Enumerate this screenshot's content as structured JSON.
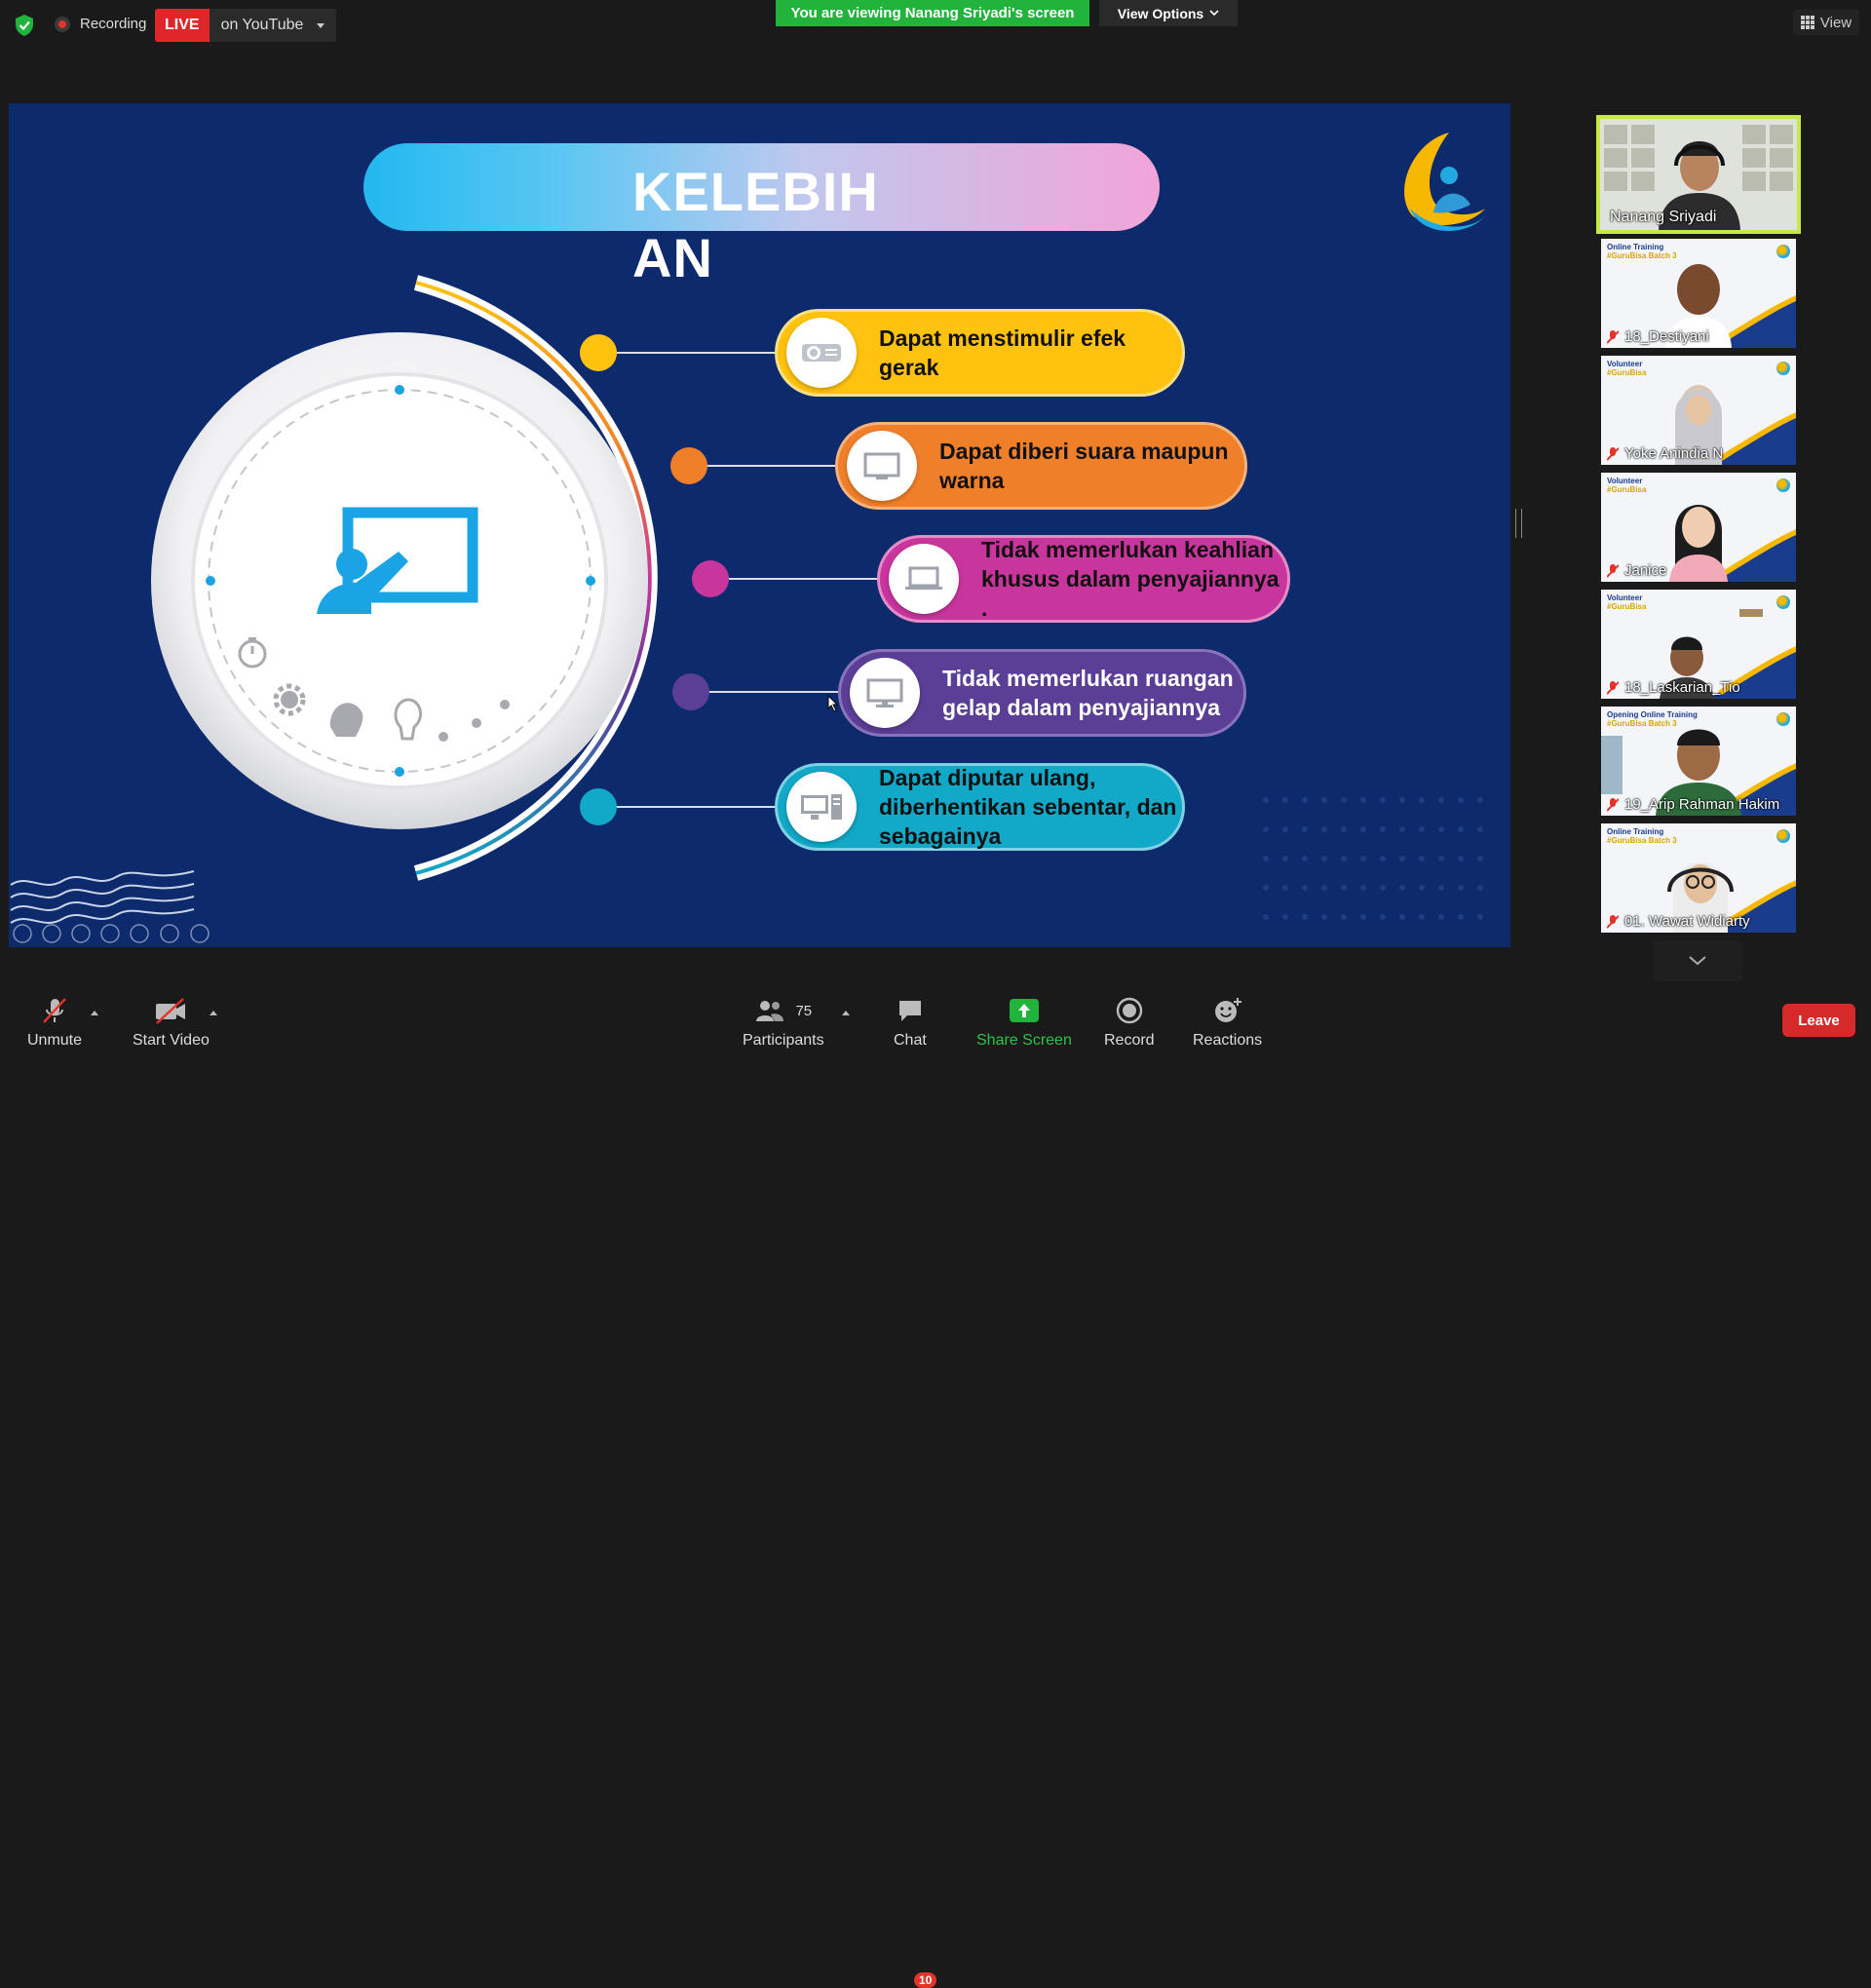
{
  "top_bar": {
    "recording_label": "Recording",
    "live_badge": "LIVE",
    "live_target": "on YouTube",
    "viewing_banner": "You are viewing Nanang Sriyadi's screen",
    "view_options": "View Options",
    "view_button": "View"
  },
  "slide": {
    "title": "KELEBIHAN",
    "items": [
      {
        "text": "Dapat menstimulir efek gerak",
        "color": "#ffc20e",
        "icon": "projector-icon"
      },
      {
        "text": "Dapat diberi suara maupun warna",
        "color": "#f07f2a",
        "icon": "monitor-icon"
      },
      {
        "text": "Tidak memerlukan keahlian khusus dalam penyajiannya .",
        "color": "#c8359d",
        "icon": "laptop-icon"
      },
      {
        "text": "Tidak memerlukan ruangan gelap dalam penyajiannya",
        "color": "#5b3f96",
        "icon": "desktop-icon"
      },
      {
        "text": "Dapat diputar ulang, diberhentikan sebentar, dan sebagainya",
        "color": "#12a8c8",
        "icon": "computer-icon"
      }
    ]
  },
  "participants_panel": {
    "active_speaker": "Nanang Sriyadi",
    "tiles": [
      {
        "name": "18_Destiyani",
        "tag_line1": "Online Training",
        "tag_line2": "#GuruBisa Batch 3"
      },
      {
        "name": "Yoke Anindia N",
        "tag_line1": "Volunteer",
        "tag_line2": "#GuruBisa"
      },
      {
        "name": "Janice",
        "tag_line1": "Volunteer",
        "tag_line2": "#GuruBisa"
      },
      {
        "name": "18_Laskarian_Tio",
        "tag_line1": "Volunteer",
        "tag_line2": "#GuruBisa"
      },
      {
        "name": "19_Arip Rahman Hakim",
        "tag_line1": "Opening Online Training",
        "tag_line2": "#GuruBisa Batch 3"
      },
      {
        "name": "01. Wawat Widiarty",
        "tag_line1": "Online Training",
        "tag_line2": "#GuruBisa Batch 3"
      }
    ]
  },
  "bottom_bar": {
    "unmute": "Unmute",
    "start_video": "Start Video",
    "participants_count": "75",
    "participants": "Participants",
    "chat": "Chat",
    "chat_badge": "10",
    "share_screen": "Share Screen",
    "record": "Record",
    "reactions": "Reactions",
    "leave": "Leave"
  },
  "colors": {
    "slide_bg": "#0c2a6c",
    "share_green": "#22b33c",
    "leave_red": "#d62a2a",
    "speaker_border": "#c6e84a"
  }
}
